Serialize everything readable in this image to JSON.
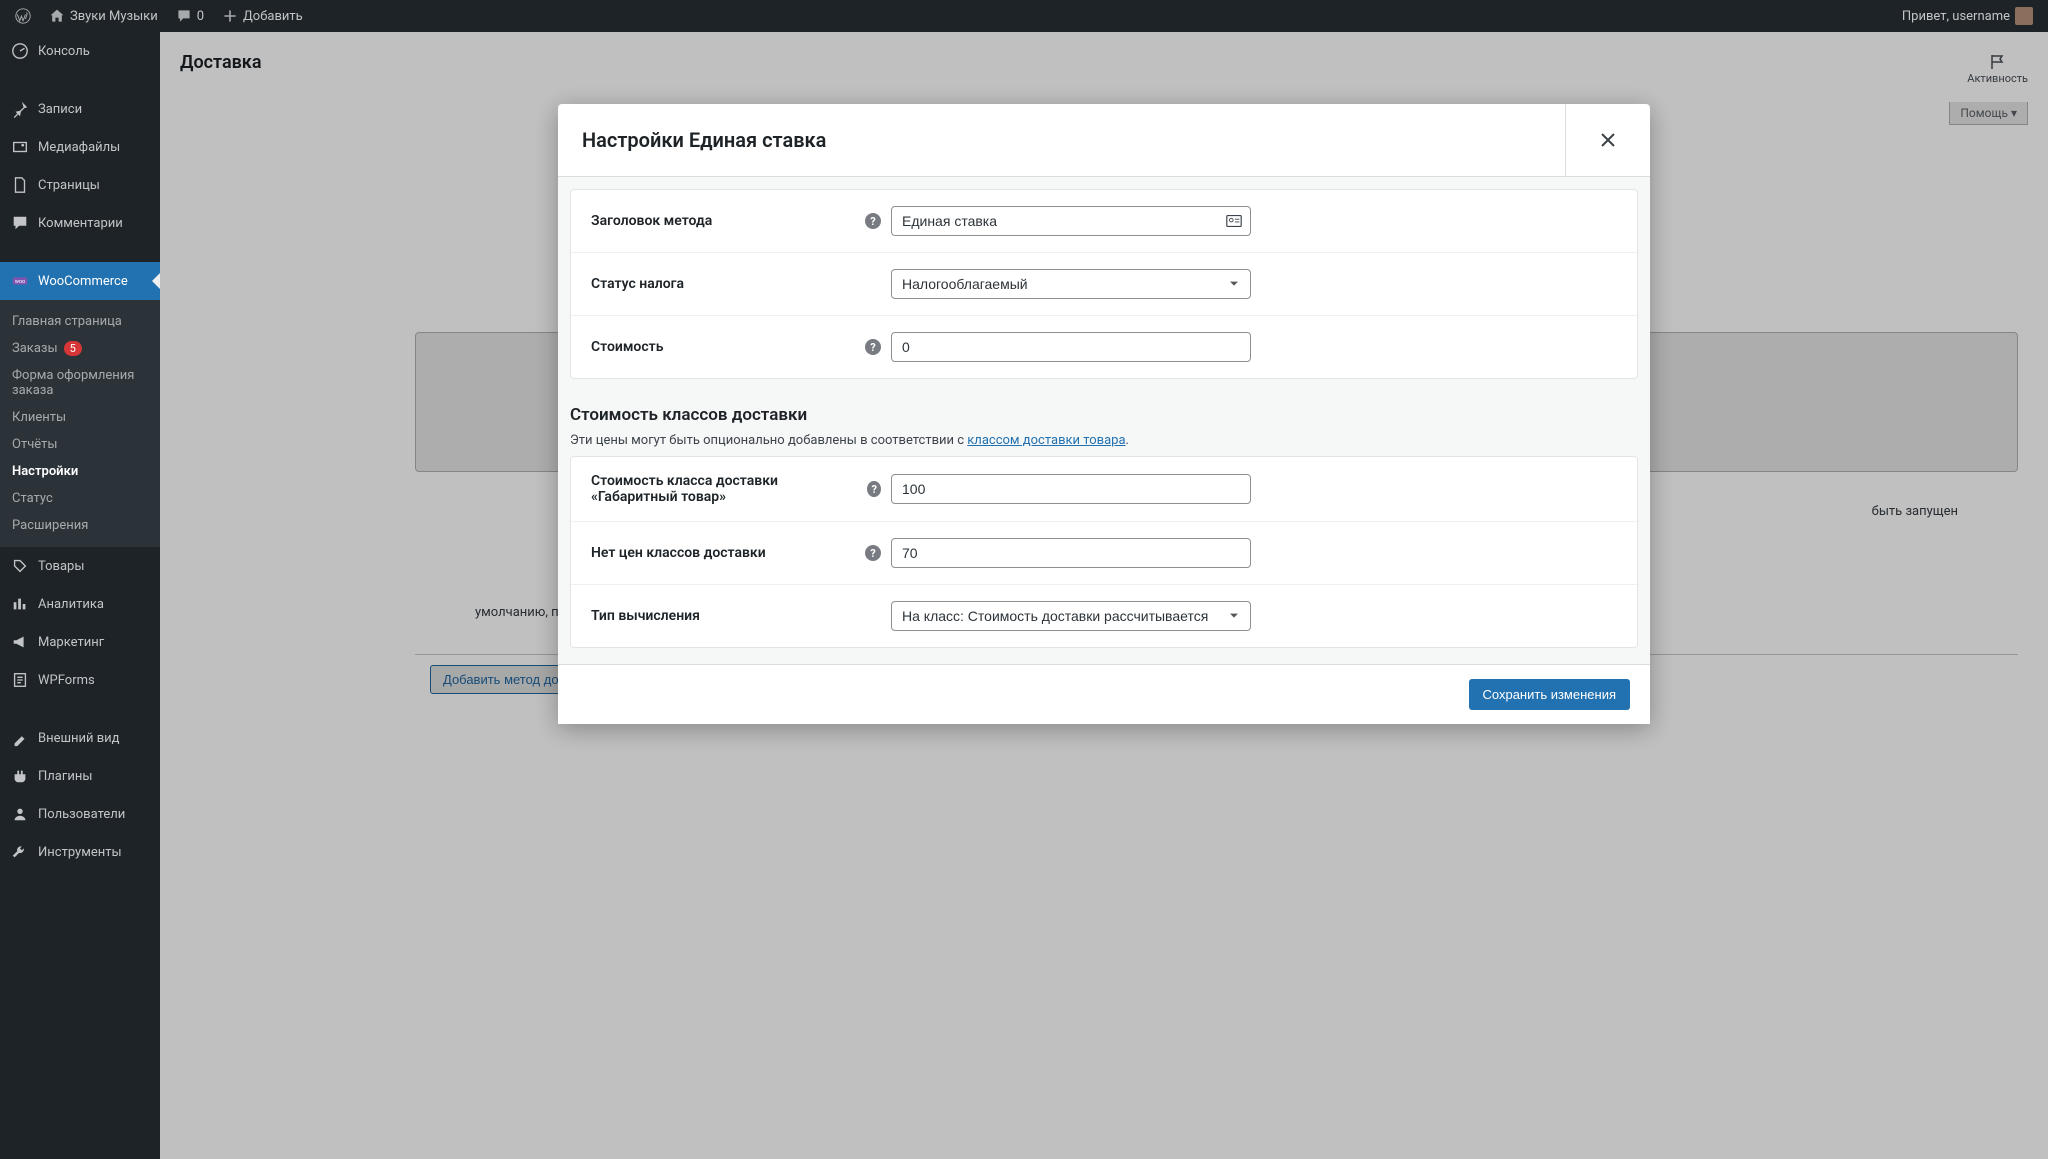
{
  "adminBar": {
    "siteName": "Звуки Музыки",
    "commentCount": "0",
    "addNew": "Добавить",
    "greeting": "Привет, username"
  },
  "sidebar": {
    "console": "Консоль",
    "posts": "Записи",
    "media": "Медиафайлы",
    "pages": "Страницы",
    "comments": "Комментарии",
    "woocommerce": "WooCommerce",
    "wcSub": {
      "home": "Главная страница",
      "orders": "Заказы",
      "ordersBadge": "5",
      "checkout": "Форма оформления заказа",
      "customers": "Клиенты",
      "reports": "Отчёты",
      "settings": "Настройки",
      "status": "Статус",
      "extensions": "Расширения"
    },
    "products": "Товары",
    "analytics": "Аналитика",
    "marketing": "Маркетинг",
    "wpforms": "WPForms",
    "appearance": "Внешний вид",
    "plugins": "Плагины",
    "users": "Пользователи",
    "tools": "Инструменты"
  },
  "page": {
    "title": "Доставка",
    "activity": "Активность",
    "help": "Помощь",
    "bgText1": "быть запущен",
    "bgText2": "умолчанию, при использовании самовывоза, базовые налоги будут рассчитаны независимо от адреса пользователя.",
    "addMethod": "Добавить метод доставки"
  },
  "modal": {
    "title": "Настройки Единая ставка",
    "fields": {
      "methodTitle": {
        "label": "Заголовок метода",
        "value": "Единая ставка"
      },
      "taxStatus": {
        "label": "Статус налога",
        "value": "Налогооблагаемый"
      },
      "cost": {
        "label": "Стоимость",
        "value": "0"
      }
    },
    "classSection": {
      "heading": "Стоимость классов доставки",
      "descPrefix": "Эти цены могут быть опционально добавлены в соответствии с ",
      "descLink": "классом доставки товара",
      "descSuffix": "."
    },
    "classFields": {
      "gabarit": {
        "label": "Стоимость класса доставки «Габаритный товар»",
        "value": "100"
      },
      "noClass": {
        "label": "Нет цен классов доставки",
        "value": "70"
      },
      "calcType": {
        "label": "Тип вычисления",
        "value": "На класс: Стоимость доставки рассчитывается"
      }
    },
    "save": "Сохранить изменения"
  }
}
